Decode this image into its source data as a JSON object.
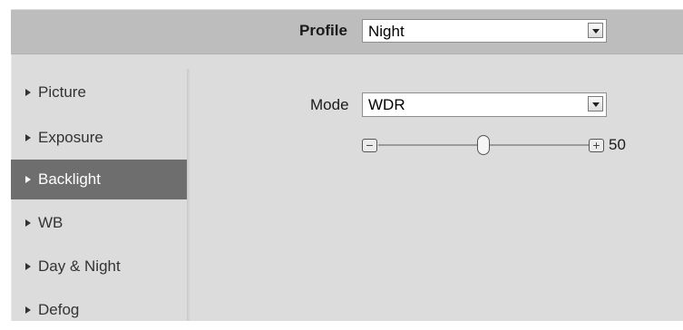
{
  "header": {
    "profile_label": "Profile",
    "profile_value": "Night"
  },
  "sidebar": {
    "items": [
      {
        "label": "Picture",
        "active": false
      },
      {
        "label": "Exposure",
        "active": false
      },
      {
        "label": "Backlight",
        "active": true
      },
      {
        "label": "WB",
        "active": false
      },
      {
        "label": "Day & Night",
        "active": false
      },
      {
        "label": "Defog",
        "active": false
      }
    ]
  },
  "main": {
    "mode_label": "Mode",
    "mode_value": "WDR",
    "slider": {
      "value": "50",
      "min": 0,
      "max": 100,
      "minus_symbol": "−",
      "plus_symbol": "+"
    }
  },
  "colors": {
    "header_bg": "#bdbdbd",
    "panel_bg": "#dcdcdc",
    "active_item_bg": "#6e6e6e"
  }
}
